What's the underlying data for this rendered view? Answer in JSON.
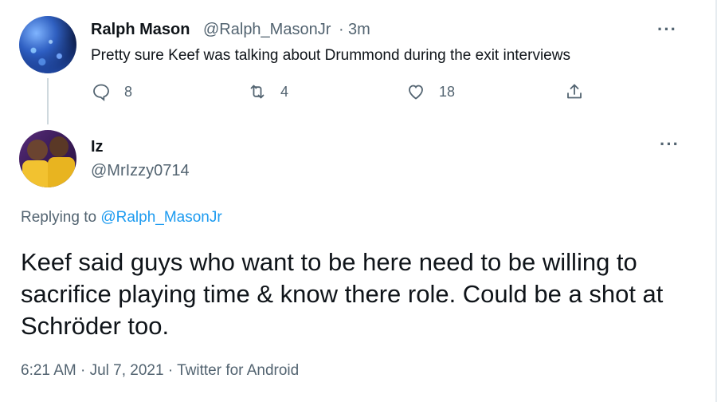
{
  "parent_tweet": {
    "display_name": "Ralph Mason",
    "handle": "@Ralph_MasonJr",
    "separator": "·",
    "time": "3m",
    "text": "Pretty sure Keef was talking about Drummond during the exit interviews",
    "more_icon": "more-horizontal-icon",
    "actions": {
      "reply": {
        "icon": "reply-icon",
        "count": "8"
      },
      "retweet": {
        "icon": "retweet-icon",
        "count": "4"
      },
      "like": {
        "icon": "heart-icon",
        "count": "18"
      },
      "share": {
        "icon": "share-icon"
      }
    }
  },
  "main_tweet": {
    "display_name": "Iz",
    "handle": "@MrIzzy0714",
    "replying_prefix": "Replying to",
    "replying_handle": "@Ralph_MasonJr",
    "text": "Keef said guys who want to be here need to be willing to sacrifice playing time & know there role. Could be a shot at Schröder too.",
    "meta": "6:21 AM · Jul 7, 2021 · Twitter for Android",
    "more_icon": "more-horizontal-icon"
  },
  "colors": {
    "text_primary": "#0f1419",
    "text_secondary": "#536471",
    "link": "#1d9bf0",
    "thread_line": "#cfd9de"
  }
}
